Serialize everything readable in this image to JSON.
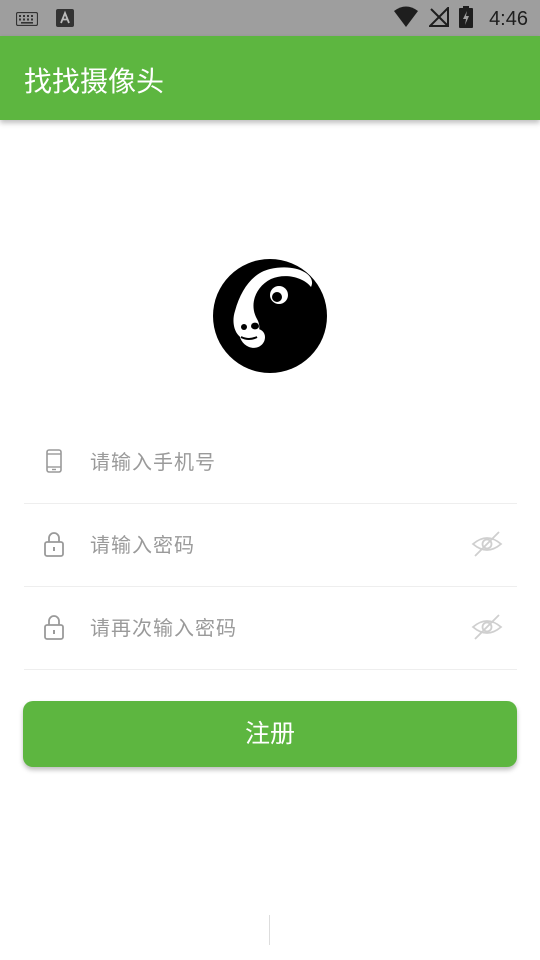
{
  "status_bar": {
    "time": "4:46",
    "icons": [
      "keyboard-icon",
      "a-app-icon",
      "wifi-icon",
      "no-signal-icon",
      "battery-charging-icon"
    ]
  },
  "app_bar": {
    "title": "找找摄像头"
  },
  "logo": {
    "icon": "panda-logo-icon"
  },
  "form": {
    "phone": {
      "placeholder": "请输入手机号",
      "icon": "phone-icon"
    },
    "password": {
      "placeholder": "请输入密码",
      "icon": "lock-icon",
      "toggle_icon": "eye-off-icon"
    },
    "confirm_password": {
      "placeholder": "请再次输入密码",
      "icon": "lock-icon",
      "toggle_icon": "eye-off-icon"
    }
  },
  "register_button": {
    "label": "注册"
  },
  "colors": {
    "brand_green": "#5db640",
    "status_bar": "#9e9e9e",
    "placeholder": "#9a9a9a"
  }
}
